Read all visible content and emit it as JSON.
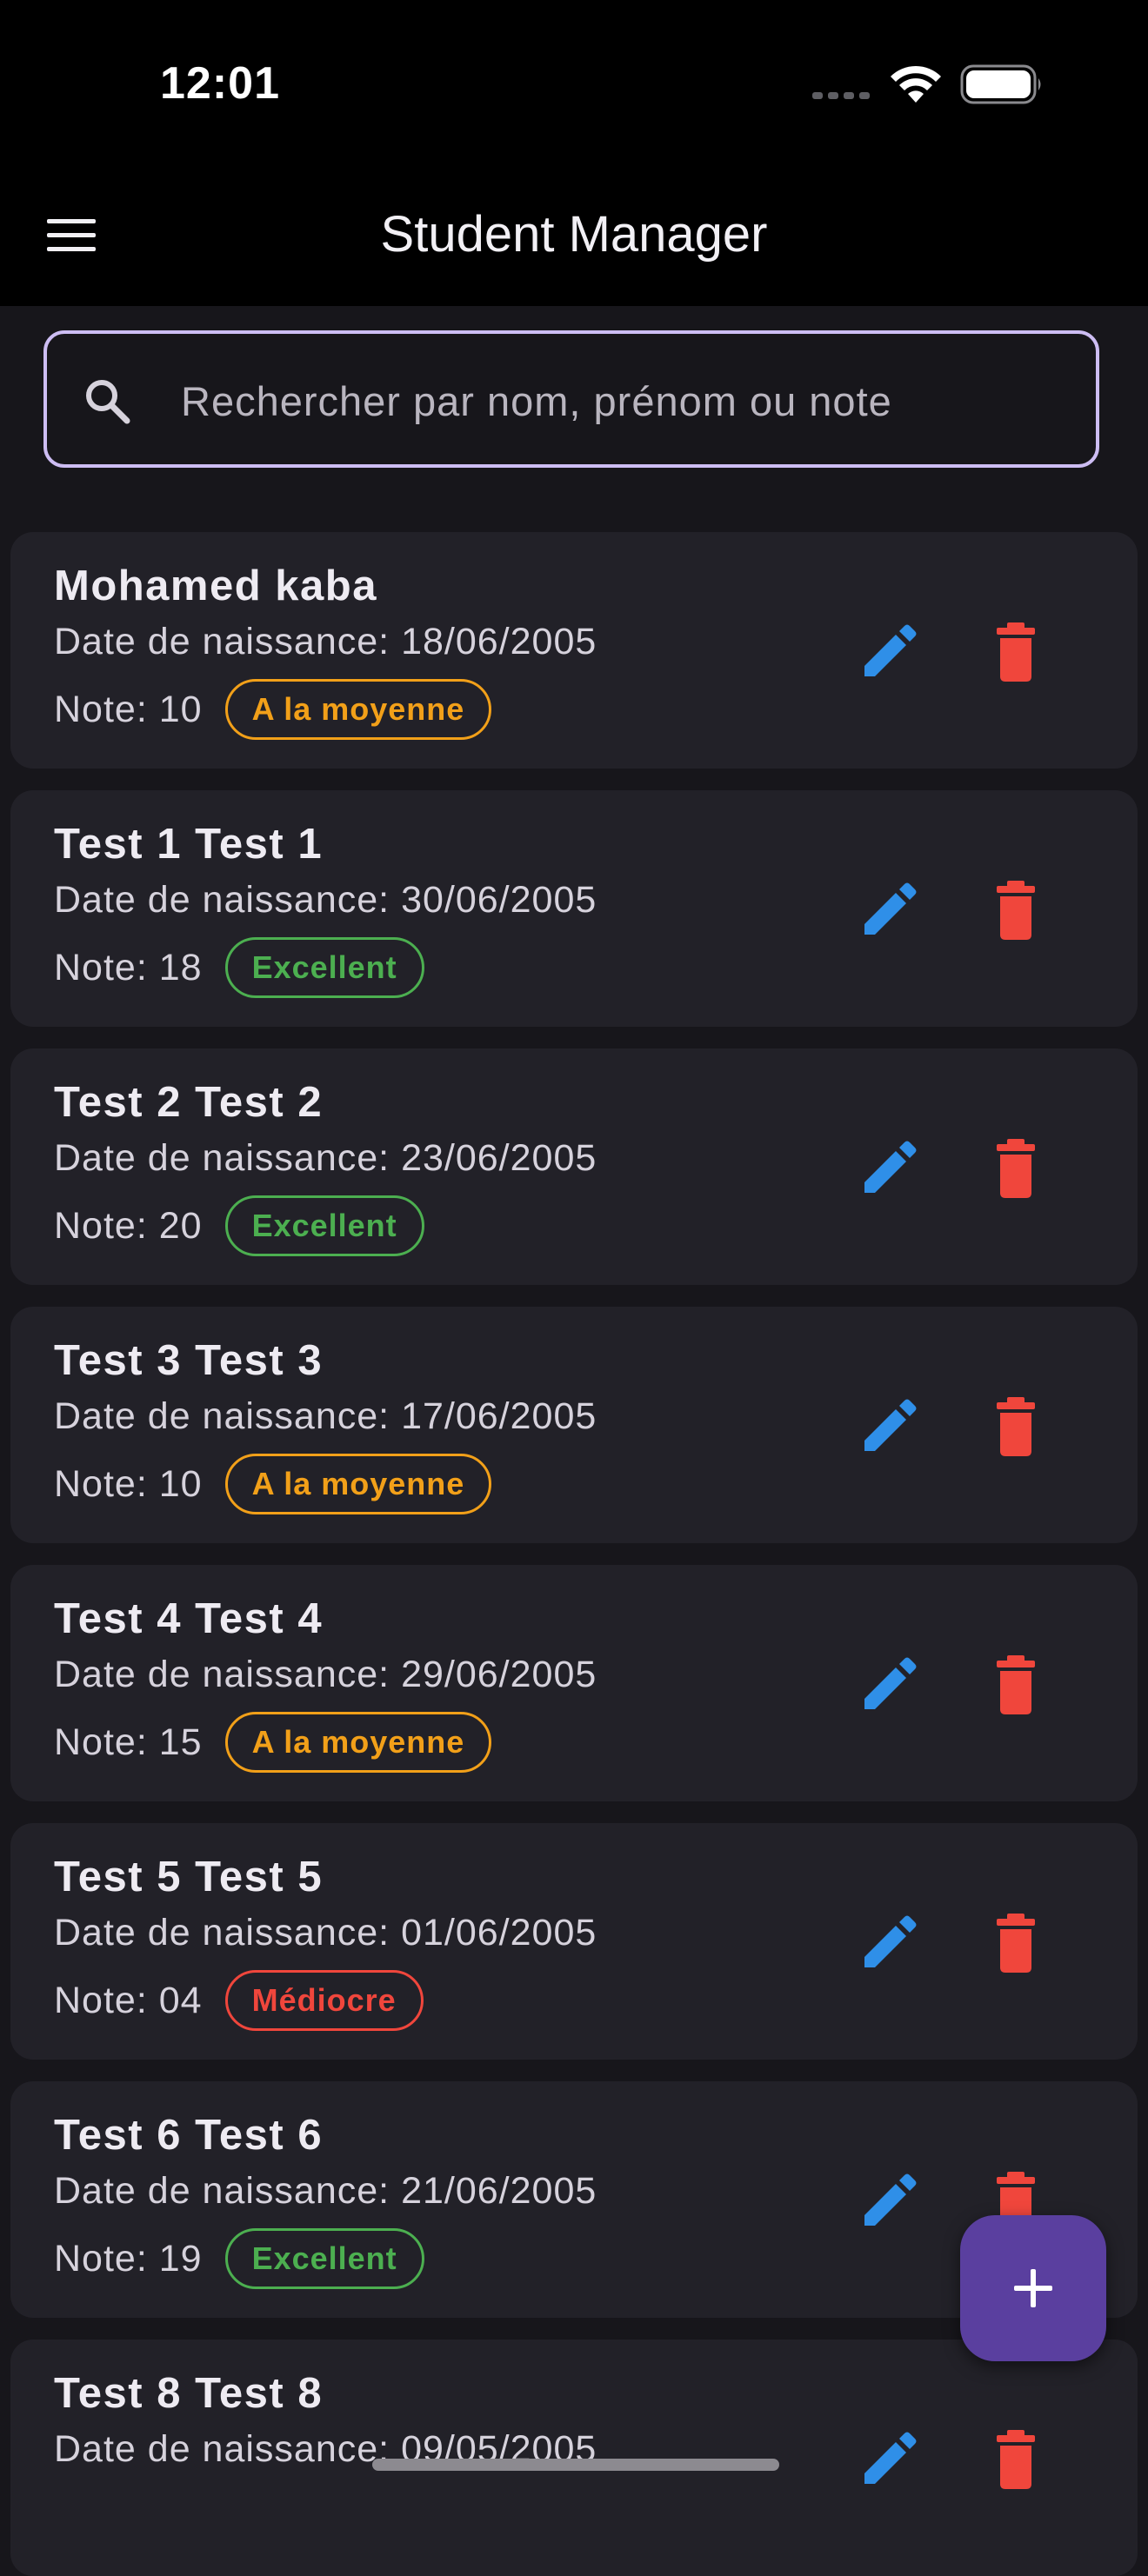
{
  "status_bar": {
    "time": "12:01"
  },
  "app_bar": {
    "title": "Student Manager"
  },
  "search": {
    "placeholder": "Rechercher par nom, prénom ou note",
    "value": ""
  },
  "labels": {
    "dob_prefix": "Date de naissance: ",
    "note_prefix": "Note: "
  },
  "colors": {
    "search_border": "#cdbdf3",
    "fab": "#5a3f9f",
    "edit_icon": "#2f8fe8",
    "delete_icon": "#f0463c",
    "badge_average": "#f2a019",
    "badge_excellent": "#4caf50",
    "badge_poor": "#f0463c"
  },
  "students": [
    {
      "name": "Mohamed kaba",
      "dob": "18/06/2005",
      "note": "10",
      "badge": "A la moyenne",
      "badge_color": "#f2a019"
    },
    {
      "name": "Test 1 Test 1",
      "dob": "30/06/2005",
      "note": "18",
      "badge": "Excellent",
      "badge_color": "#4caf50"
    },
    {
      "name": "Test 2 Test 2",
      "dob": "23/06/2005",
      "note": "20",
      "badge": "Excellent",
      "badge_color": "#4caf50"
    },
    {
      "name": "Test 3 Test 3",
      "dob": "17/06/2005",
      "note": "10",
      "badge": "A la moyenne",
      "badge_color": "#f2a019"
    },
    {
      "name": "Test 4 Test 4",
      "dob": "29/06/2005",
      "note": "15",
      "badge": "A la moyenne",
      "badge_color": "#f2a019"
    },
    {
      "name": "Test 5 Test 5",
      "dob": "01/06/2005",
      "note": "04",
      "badge": "Médiocre",
      "badge_color": "#f0463c"
    },
    {
      "name": "Test 6 Test 6",
      "dob": "21/06/2005",
      "note": "19",
      "badge": "Excellent",
      "badge_color": "#4caf50"
    },
    {
      "name": "Test 8 Test 8",
      "dob": "09/05/2005",
      "note": "",
      "badge": "",
      "badge_color": "#4caf50"
    }
  ],
  "icons": {
    "menu": "menu-icon",
    "search": "search-icon",
    "edit": "pencil-icon",
    "delete": "trash-icon",
    "add": "plus-icon",
    "wifi": "wifi-icon",
    "battery": "battery-icon"
  }
}
